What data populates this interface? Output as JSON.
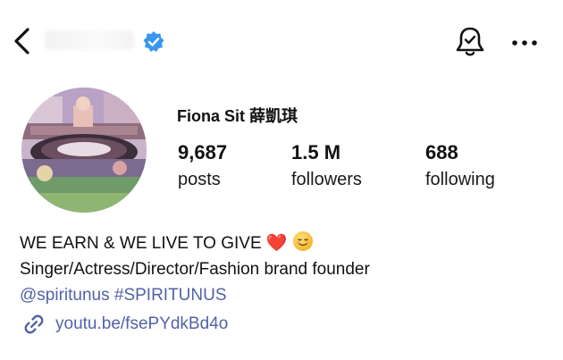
{
  "header": {
    "back_icon": "chevron-left-icon",
    "verified_icon": "verified-badge-icon",
    "notify_icon": "bell-check-icon",
    "more_icon": "more-horizontal-icon"
  },
  "profile": {
    "name": "Fiona Sit 薛凱琪",
    "stats": [
      {
        "value": "9,687",
        "label": "posts"
      },
      {
        "value": "1.5 M",
        "label": "followers"
      },
      {
        "value": "688",
        "label": "following"
      }
    ]
  },
  "bio": {
    "line1": "WE EARN & WE LIVE TO GIVE",
    "line1_emoji_heart": "❤️",
    "line2": "Singer/Actress/Director/Fashion brand founder",
    "line3": "@spiritunus #SPIRITUNUS",
    "link": "youtu.be/fsePYdkBd4o"
  },
  "colors": {
    "link": "#5163a6",
    "verified": "#3897f0",
    "heart": "#e0302d"
  }
}
